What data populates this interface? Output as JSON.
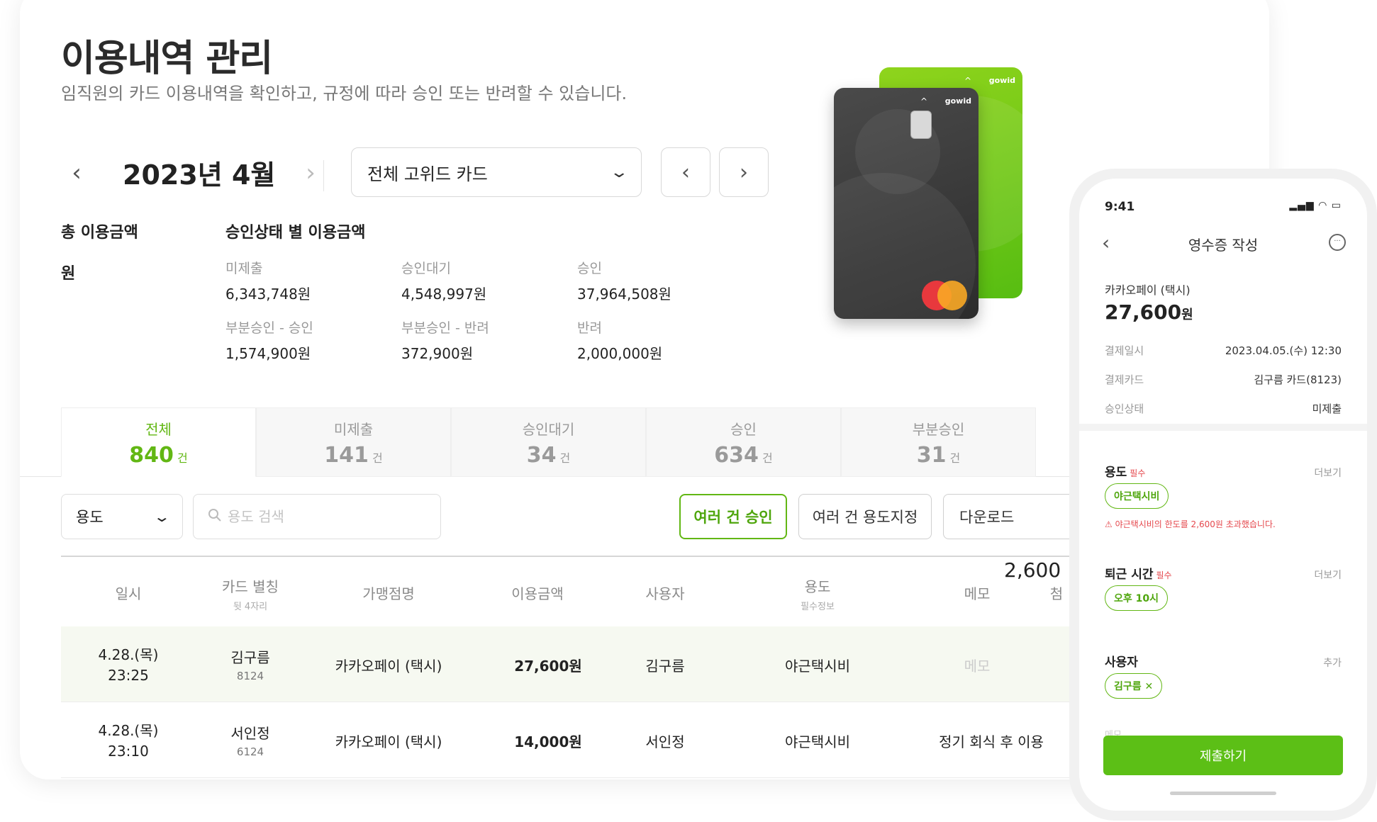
{
  "header": {
    "title": "이용내역 관리",
    "subtitle": "임직원의 카드 이용내역을 확인하고, 규정에 따라 승인 또는 반려할 수 있습니다."
  },
  "month_nav": {
    "prev": "‹",
    "label": "2023년 4월",
    "next": "›"
  },
  "card_select": {
    "value": "전체 고위드 카드",
    "chevron": "⌄"
  },
  "pager": {
    "prev": "‹",
    "next": "›"
  },
  "summary": {
    "total_label": "총 이용금액",
    "total_value": "원",
    "by_status_label": "승인상태 별 이용금액",
    "stats": [
      {
        "label": "미제출",
        "value": "6,343,748원"
      },
      {
        "label": "승인대기",
        "value": "4,548,997원"
      },
      {
        "label": "승인",
        "value": "37,964,508원"
      },
      {
        "label": "부분승인 - 승인",
        "value": "1,574,900원"
      },
      {
        "label": "부분승인 - 반려",
        "value": "372,900원"
      },
      {
        "label": "반려",
        "value": "2,000,000원"
      }
    ]
  },
  "cards": {
    "brand": "gowid",
    "caret": "^"
  },
  "tabs": [
    {
      "label": "전체",
      "count": "840",
      "unit": "건",
      "active": true
    },
    {
      "label": "미제출",
      "count": "141",
      "unit": "건"
    },
    {
      "label": "승인대기",
      "count": "34",
      "unit": "건"
    },
    {
      "label": "승인",
      "count": "634",
      "unit": "건"
    },
    {
      "label": "부분승인",
      "count": "31",
      "unit": "건"
    }
  ],
  "filters": {
    "purpose_label": "용도",
    "purpose_chevron": "⌄",
    "search_placeholder": "용도 검색",
    "bulk_approve": "여러 건 승인",
    "bulk_assign": "여러 건 용도지정",
    "download": "다운로드"
  },
  "table": {
    "headers": {
      "date": "일시",
      "card": "카드 별칭",
      "card_sub": "뒷 4자리",
      "merchant": "가맹점명",
      "amount": "이용금액",
      "user": "사용자",
      "purpose": "용도",
      "purpose_sub": "필수정보",
      "memo": "메모",
      "attach": "첨"
    },
    "floating_value": "2,600",
    "rows": [
      {
        "date": "4.28.(목)",
        "time": "23:25",
        "card": "김구름",
        "card_last4": "8124",
        "merchant": "카카오페이 (택시)",
        "amount": "27,600원",
        "user": "김구름",
        "purpose": "야근택시비",
        "memo": "메모"
      },
      {
        "date": "4.28.(목)",
        "time": "23:10",
        "card": "서인정",
        "card_last4": "6124",
        "merchant": "카카오페이 (택시)",
        "amount": "14,000원",
        "user": "서인정",
        "purpose": "야근택시비",
        "memo": "정기 회식 후 이용"
      }
    ]
  },
  "phone": {
    "time": "9:41",
    "status": "▂▄▆ ◠ ▭",
    "back": "‹",
    "title": "영수증 작성",
    "chat": "···",
    "merchant": "카카오페이 (택시)",
    "amount": "27,600",
    "amount_unit": "원",
    "details": [
      {
        "key": "결제일시",
        "value": "2023.04.05.(수) 12:30"
      },
      {
        "key": "결제카드",
        "value": "김구름 카드(8123)"
      },
      {
        "key": "승인상태",
        "value": "미제출"
      }
    ],
    "purpose": {
      "title": "용도",
      "required": "필수",
      "more": "더보기",
      "value": "야근택시비",
      "warning": "⚠ 야근택시비의 한도를 2,600원 초과했습니다."
    },
    "leave": {
      "title": "퇴근 시간",
      "required": "필수",
      "more": "더보기",
      "value": "오후 10시"
    },
    "user": {
      "title": "사용자",
      "more": "추가",
      "value": "김구름 ✕"
    },
    "memo_label": "메모",
    "submit": "제출하기"
  }
}
